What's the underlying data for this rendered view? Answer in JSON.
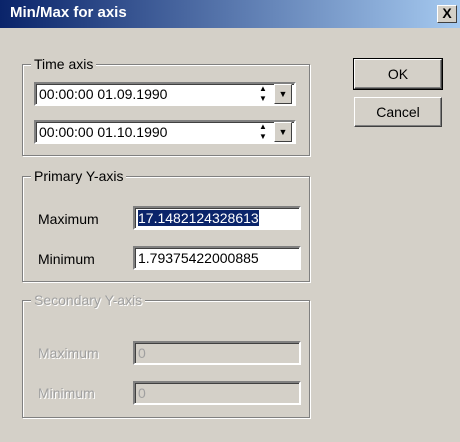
{
  "window": {
    "title": "Min/Max for axis",
    "close_label": "X"
  },
  "time_axis": {
    "legend": "Time axis",
    "start": "00:00:00 01.09.1990",
    "end": "00:00:00 01.10.1990"
  },
  "primary_y": {
    "legend": "Primary Y-axis",
    "max_label": "Maximum",
    "max_value": "17.1482124328613",
    "min_label": "Minimum",
    "min_value": "1.79375422000885"
  },
  "secondary_y": {
    "legend": "Secondary Y-axis",
    "max_label": "Maximum",
    "max_value": "0",
    "min_label": "Minimum",
    "min_value": "0"
  },
  "buttons": {
    "ok": "OK",
    "cancel": "Cancel"
  }
}
